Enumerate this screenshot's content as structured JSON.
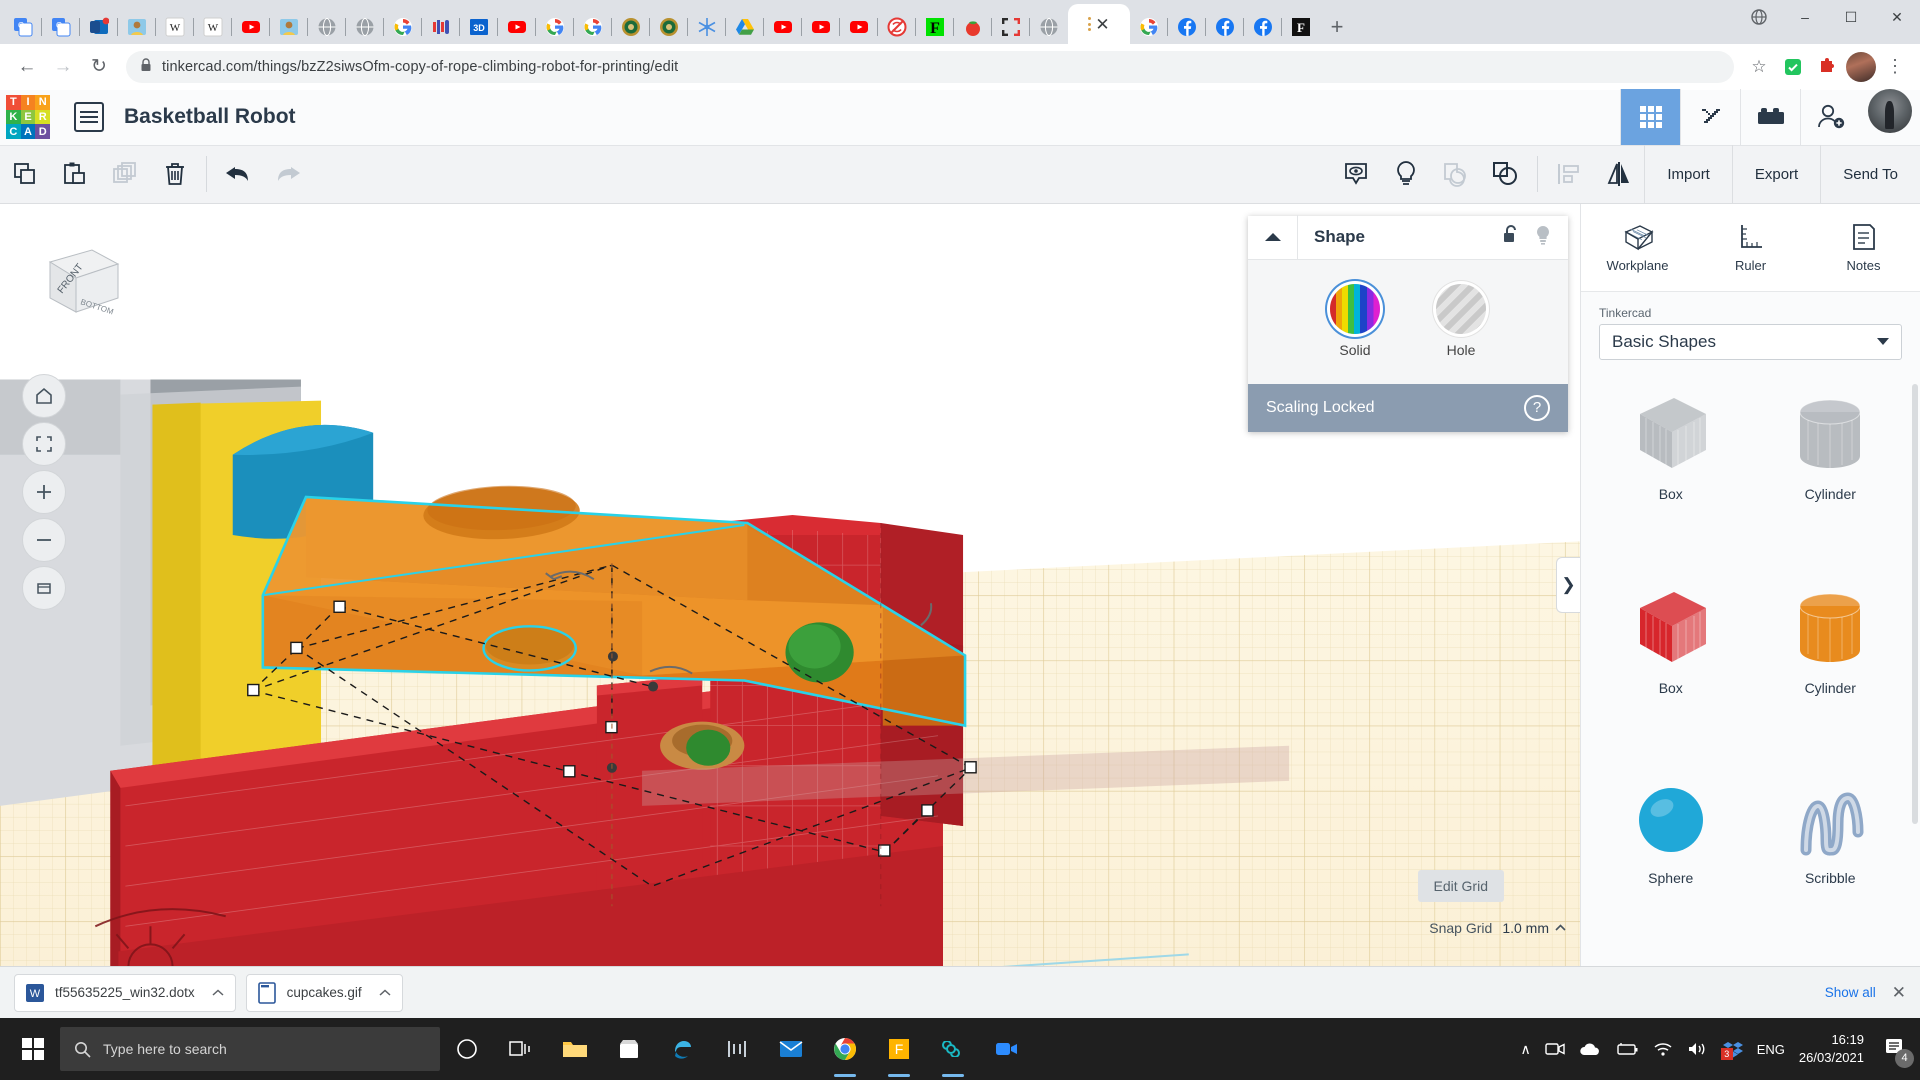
{
  "browser": {
    "favicon_tabs": [
      {
        "name": "google-translate-tab",
        "icon": "translate"
      },
      {
        "name": "google-translate-tab",
        "icon": "translate"
      },
      {
        "name": "outlook-tab",
        "icon": "outlook"
      },
      {
        "name": "wikipedia-image-tab",
        "icon": "photo"
      },
      {
        "name": "wikipedia-tab",
        "icon": "wikipedia"
      },
      {
        "name": "wikipedia-tab",
        "icon": "wikipedia"
      },
      {
        "name": "youtube-tab",
        "icon": "youtube"
      },
      {
        "name": "wikipedia-image-tab",
        "icon": "photo"
      },
      {
        "name": "globe-tab",
        "icon": "globe"
      },
      {
        "name": "globe-tab",
        "icon": "globe"
      },
      {
        "name": "google-tab",
        "icon": "google"
      },
      {
        "name": "scratch-tab",
        "icon": "blocks"
      },
      {
        "name": "3d-tab",
        "icon": "3d"
      },
      {
        "name": "youtube-tab",
        "icon": "youtube"
      },
      {
        "name": "google-tab",
        "icon": "google"
      },
      {
        "name": "google-tab",
        "icon": "google"
      },
      {
        "name": "seal-tab",
        "icon": "seal"
      },
      {
        "name": "seal-tab",
        "icon": "seal"
      },
      {
        "name": "snowflake-tab",
        "icon": "snowflake"
      },
      {
        "name": "google-drive-tab",
        "icon": "drive"
      },
      {
        "name": "youtube-tab",
        "icon": "youtube"
      },
      {
        "name": "youtube-tab",
        "icon": "youtube"
      },
      {
        "name": "youtube-tab",
        "icon": "youtube"
      },
      {
        "name": "no-sync-tab",
        "icon": "nosync"
      },
      {
        "name": "fiverr-tab",
        "icon": "f-green"
      },
      {
        "name": "tomato-tab",
        "icon": "tomato"
      },
      {
        "name": "crop-tab",
        "icon": "crop"
      },
      {
        "name": "globe-tab",
        "icon": "globe"
      }
    ],
    "active_tab": {
      "name": "tinkercad-tab",
      "loading": true,
      "close_label": "✕"
    },
    "trailing_tabs": [
      {
        "name": "google-tab",
        "icon": "google"
      },
      {
        "name": "facebook-tab",
        "icon": "facebook"
      },
      {
        "name": "facebook-tab",
        "icon": "facebook"
      },
      {
        "name": "facebook-tab",
        "icon": "facebook"
      },
      {
        "name": "fandom-tab",
        "icon": "f-black"
      }
    ],
    "new_tab_label": "+",
    "window_controls": {
      "minimize": "–",
      "maximize": "☐",
      "close": "✕"
    },
    "nav": {
      "back": "←",
      "forward": "→",
      "reload": "↻"
    },
    "address": {
      "lock_icon": "lock-icon",
      "url": "tinkercad.com/things/bzZ2siwsOfm-copy-of-rope-climbing-robot-for-printing/edit",
      "domain": "tinkercad.com"
    },
    "omni_right": {
      "bookmark": "☆",
      "extension_badge": "✓",
      "puzzle": "puzzle-icon",
      "menu": "⋮"
    }
  },
  "tinkercad": {
    "logo_tiles": [
      {
        "letter": "T",
        "color": "#f04e37"
      },
      {
        "letter": "I",
        "color": "#f58220"
      },
      {
        "letter": "N",
        "color": "#f9a21a"
      },
      {
        "letter": "K",
        "color": "#2fb24a"
      },
      {
        "letter": "E",
        "color": "#8dc63f"
      },
      {
        "letter": "R",
        "color": "#d7df23"
      },
      {
        "letter": "C",
        "color": "#00a6c0"
      },
      {
        "letter": "A",
        "color": "#0073bc"
      },
      {
        "letter": "D",
        "color": "#6d4fa0"
      }
    ],
    "document_title": "Basketball Robot",
    "header_icons": [
      {
        "name": "designs-grid-icon",
        "label": "Designs",
        "active": true
      },
      {
        "name": "minecraft-pickaxe-icon",
        "label": "Minecraft",
        "active": false
      },
      {
        "name": "lego-brick-icon",
        "label": "Blocks",
        "active": false
      },
      {
        "name": "invite-person-icon",
        "label": "Invite",
        "active": false
      }
    ],
    "avatar_name": "user-avatar",
    "toolbar_left": [
      {
        "name": "copy-button",
        "label": "Copy",
        "disabled": false
      },
      {
        "name": "paste-button",
        "label": "Paste",
        "disabled": false
      },
      {
        "name": "duplicate-button",
        "label": "Duplicate",
        "disabled": true
      },
      {
        "name": "delete-button",
        "label": "Delete",
        "disabled": false
      },
      {
        "name": "undo-button",
        "label": "Undo",
        "disabled": false
      },
      {
        "name": "redo-button",
        "label": "Redo",
        "disabled": true
      }
    ],
    "toolbar_right_icons": [
      {
        "name": "show-hide-button",
        "label": "Show / Hide",
        "disabled": false
      },
      {
        "name": "hint-lightbulb-button",
        "label": "Hint",
        "disabled": false
      },
      {
        "name": "group-button",
        "label": "Group",
        "disabled": true
      },
      {
        "name": "ungroup-button",
        "label": "Ungroup",
        "disabled": false
      },
      {
        "name": "align-button",
        "label": "Align",
        "disabled": true
      },
      {
        "name": "mirror-button",
        "label": "Mirror",
        "disabled": false
      }
    ],
    "toolbar_text_buttons": [
      {
        "name": "import-button",
        "label": "Import"
      },
      {
        "name": "export-button",
        "label": "Export"
      },
      {
        "name": "send-to-button",
        "label": "Send To"
      }
    ],
    "inspector": {
      "title": "Shape",
      "collapse_icon": "chevron-up-icon",
      "lock_icon": "unlocked-padlock-icon",
      "bulb_icon": "lightbulb-icon",
      "solid_label": "Solid",
      "hole_label": "Hole",
      "status_text": "Scaling Locked",
      "help_label": "?"
    },
    "side_tools": [
      {
        "name": "workplane-tool",
        "label": "Workplane"
      },
      {
        "name": "ruler-tool",
        "label": "Ruler"
      },
      {
        "name": "notes-tool",
        "label": "Notes"
      }
    ],
    "library": {
      "source_label": "Tinkercad",
      "selected_collection": "Basic Shapes",
      "shapes": [
        {
          "name": "shape-box-gray",
          "label": "Box",
          "color": "#b8bcc0",
          "kind": "box"
        },
        {
          "name": "shape-cylinder-gray",
          "label": "Cylinder",
          "color": "#b8bcc0",
          "kind": "cylinder"
        },
        {
          "name": "shape-box-red",
          "label": "Box",
          "color": "#d7262c",
          "kind": "box"
        },
        {
          "name": "shape-cylinder-orange",
          "label": "Cylinder",
          "color": "#e88b1e",
          "kind": "cylinder"
        },
        {
          "name": "shape-sphere-blue",
          "label": "Sphere",
          "color": "#20a8d8",
          "kind": "sphere"
        },
        {
          "name": "shape-scribble",
          "label": "Scribble",
          "color": "#8fa8c8",
          "kind": "scribble"
        }
      ]
    },
    "canvas": {
      "viewcube_front": "FRONT",
      "viewcube_bottom": "BOTTOM",
      "nav_buttons": [
        {
          "name": "home-view-button",
          "icon": "home-icon"
        },
        {
          "name": "fit-all-button",
          "icon": "expand-icon"
        },
        {
          "name": "zoom-in-button",
          "icon": "plus-icon"
        },
        {
          "name": "zoom-out-button",
          "icon": "minus-icon"
        },
        {
          "name": "ortho-perspective-button",
          "icon": "box-view-icon"
        }
      ],
      "edit_grid_label": "Edit Grid",
      "snap_grid_label": "Snap Grid",
      "snap_grid_value": "1.0 mm",
      "panel_toggle": "❯"
    }
  },
  "downloads": {
    "items": [
      {
        "name": "download-item-dotx",
        "filename": "tf55635225_win32.dotx",
        "icon": "word-icon"
      },
      {
        "name": "download-item-gif",
        "filename": "cupcakes.gif",
        "icon": "file-icon"
      }
    ],
    "show_all_label": "Show all",
    "close_label": "✕"
  },
  "taskbar": {
    "search_placeholder": "Type here to search",
    "apps": [
      {
        "name": "cortana-button",
        "icon": "circle"
      },
      {
        "name": "task-view-button",
        "icon": "taskview"
      },
      {
        "name": "file-explorer-button",
        "icon": "folder",
        "running": false
      },
      {
        "name": "microsoft-store-button",
        "icon": "store",
        "running": false
      },
      {
        "name": "edge-button",
        "icon": "edge",
        "running": false
      },
      {
        "name": "scratch-button",
        "icon": "scratch",
        "running": false
      },
      {
        "name": "mail-button",
        "icon": "mail",
        "running": false
      },
      {
        "name": "chrome-button",
        "icon": "chrome",
        "running": true
      },
      {
        "name": "fiverr-button",
        "icon": "f-app",
        "running": true
      },
      {
        "name": "tinkercad-button",
        "icon": "infinity",
        "running": true
      },
      {
        "name": "zoom-button",
        "icon": "video",
        "running": false
      }
    ],
    "tray": {
      "chevron": "∧",
      "icons": [
        "camera-icon",
        "onedrive-icon",
        "battery-icon",
        "wifi-icon",
        "volume-icon",
        "dropbox-icon"
      ],
      "dropbox_badge": "3",
      "language": "ENG",
      "time": "16:19",
      "date": "26/03/2021",
      "notification_count": "4"
    }
  }
}
